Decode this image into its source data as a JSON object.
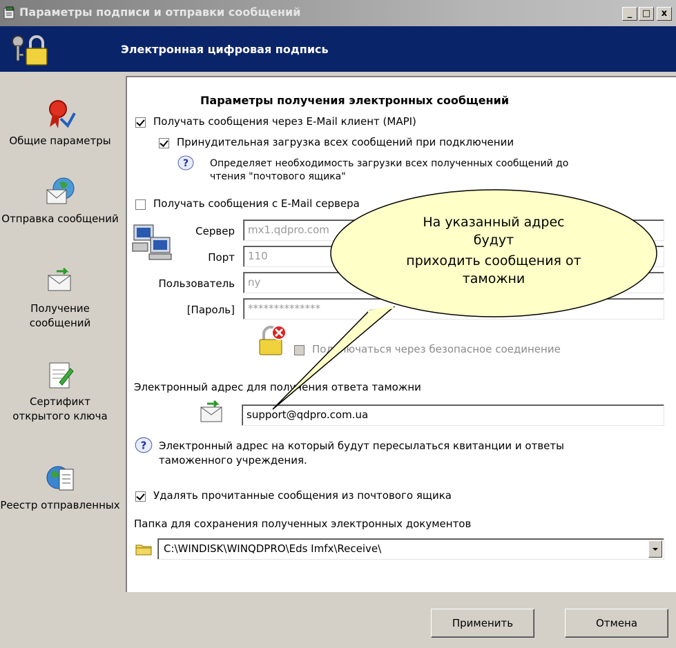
{
  "window": {
    "title": "Параметры подписи и отправки сообщений",
    "controls": {
      "minimize": "_",
      "maximize": "□",
      "close": "x"
    }
  },
  "banner": {
    "title": "Электронная цифровая подпись"
  },
  "sidebar": {
    "items": [
      {
        "label": "Общие параметры",
        "icon": "certificate-ribbon-icon"
      },
      {
        "label": "Отправка сообщений",
        "icon": "send-mail-icon"
      },
      {
        "label": "Получение сообщений",
        "icon": "receive-mail-icon"
      },
      {
        "label": "Сертификт открытого ключа",
        "icon": "certificate-edit-icon"
      },
      {
        "label": "Реестр отправленных",
        "icon": "registry-globe-icon"
      }
    ]
  },
  "main": {
    "section_title": "Параметры получения электронных сообщений",
    "mapi_checkbox": {
      "label": "Получать сообщения через E-Mail клиент (MAPI)",
      "checked": true
    },
    "force_download_checkbox": {
      "label": "Принудительная загрузка всех сообщений при подключении",
      "checked": true
    },
    "force_download_help": "Определяет необходимость загрузки всех полученных сообщений до чтения \"почтового ящика\"",
    "server_checkbox": {
      "label": "Получать сообщения с E-Mail сервера",
      "checked": false
    },
    "server": {
      "label": "Сервер",
      "value": "mx1.qdpro.com"
    },
    "port": {
      "label": "Порт",
      "value": "110"
    },
    "user": {
      "label": "Пользователь",
      "value": "ny"
    },
    "password": {
      "label": "[Пароль]",
      "value": "**************"
    },
    "secure_checkbox": {
      "label": "Подключаться через безопасное соединение",
      "checked": false
    },
    "reply_address_label": "Электронный адрес для получения ответа таможни",
    "reply_address_value": "support@qdpro.com.ua",
    "reply_address_help": "Электронный адрес на который будут пересылаться квитанции и ответы таможенного учреждения.",
    "delete_checkbox": {
      "label": "Удалять прочитанные сообщения из почтового ящика",
      "checked": true
    },
    "folder_label": "Папка для сохранения полученных электронных документов",
    "folder_value": "C:\\WINDISK\\WINQDPRO\\Eds Imfx\\Receive\\"
  },
  "footer": {
    "apply_label": "Применить",
    "cancel_label": "Отмена"
  },
  "callout": {
    "line1": "На указанный адрес",
    "line2": "будут",
    "line3": "приходить сообщения от",
    "line4": "таможни"
  },
  "colors": {
    "banner": "#0a246a",
    "callout_fill": "#ffffc8",
    "dialog": "#d4d0c8"
  }
}
